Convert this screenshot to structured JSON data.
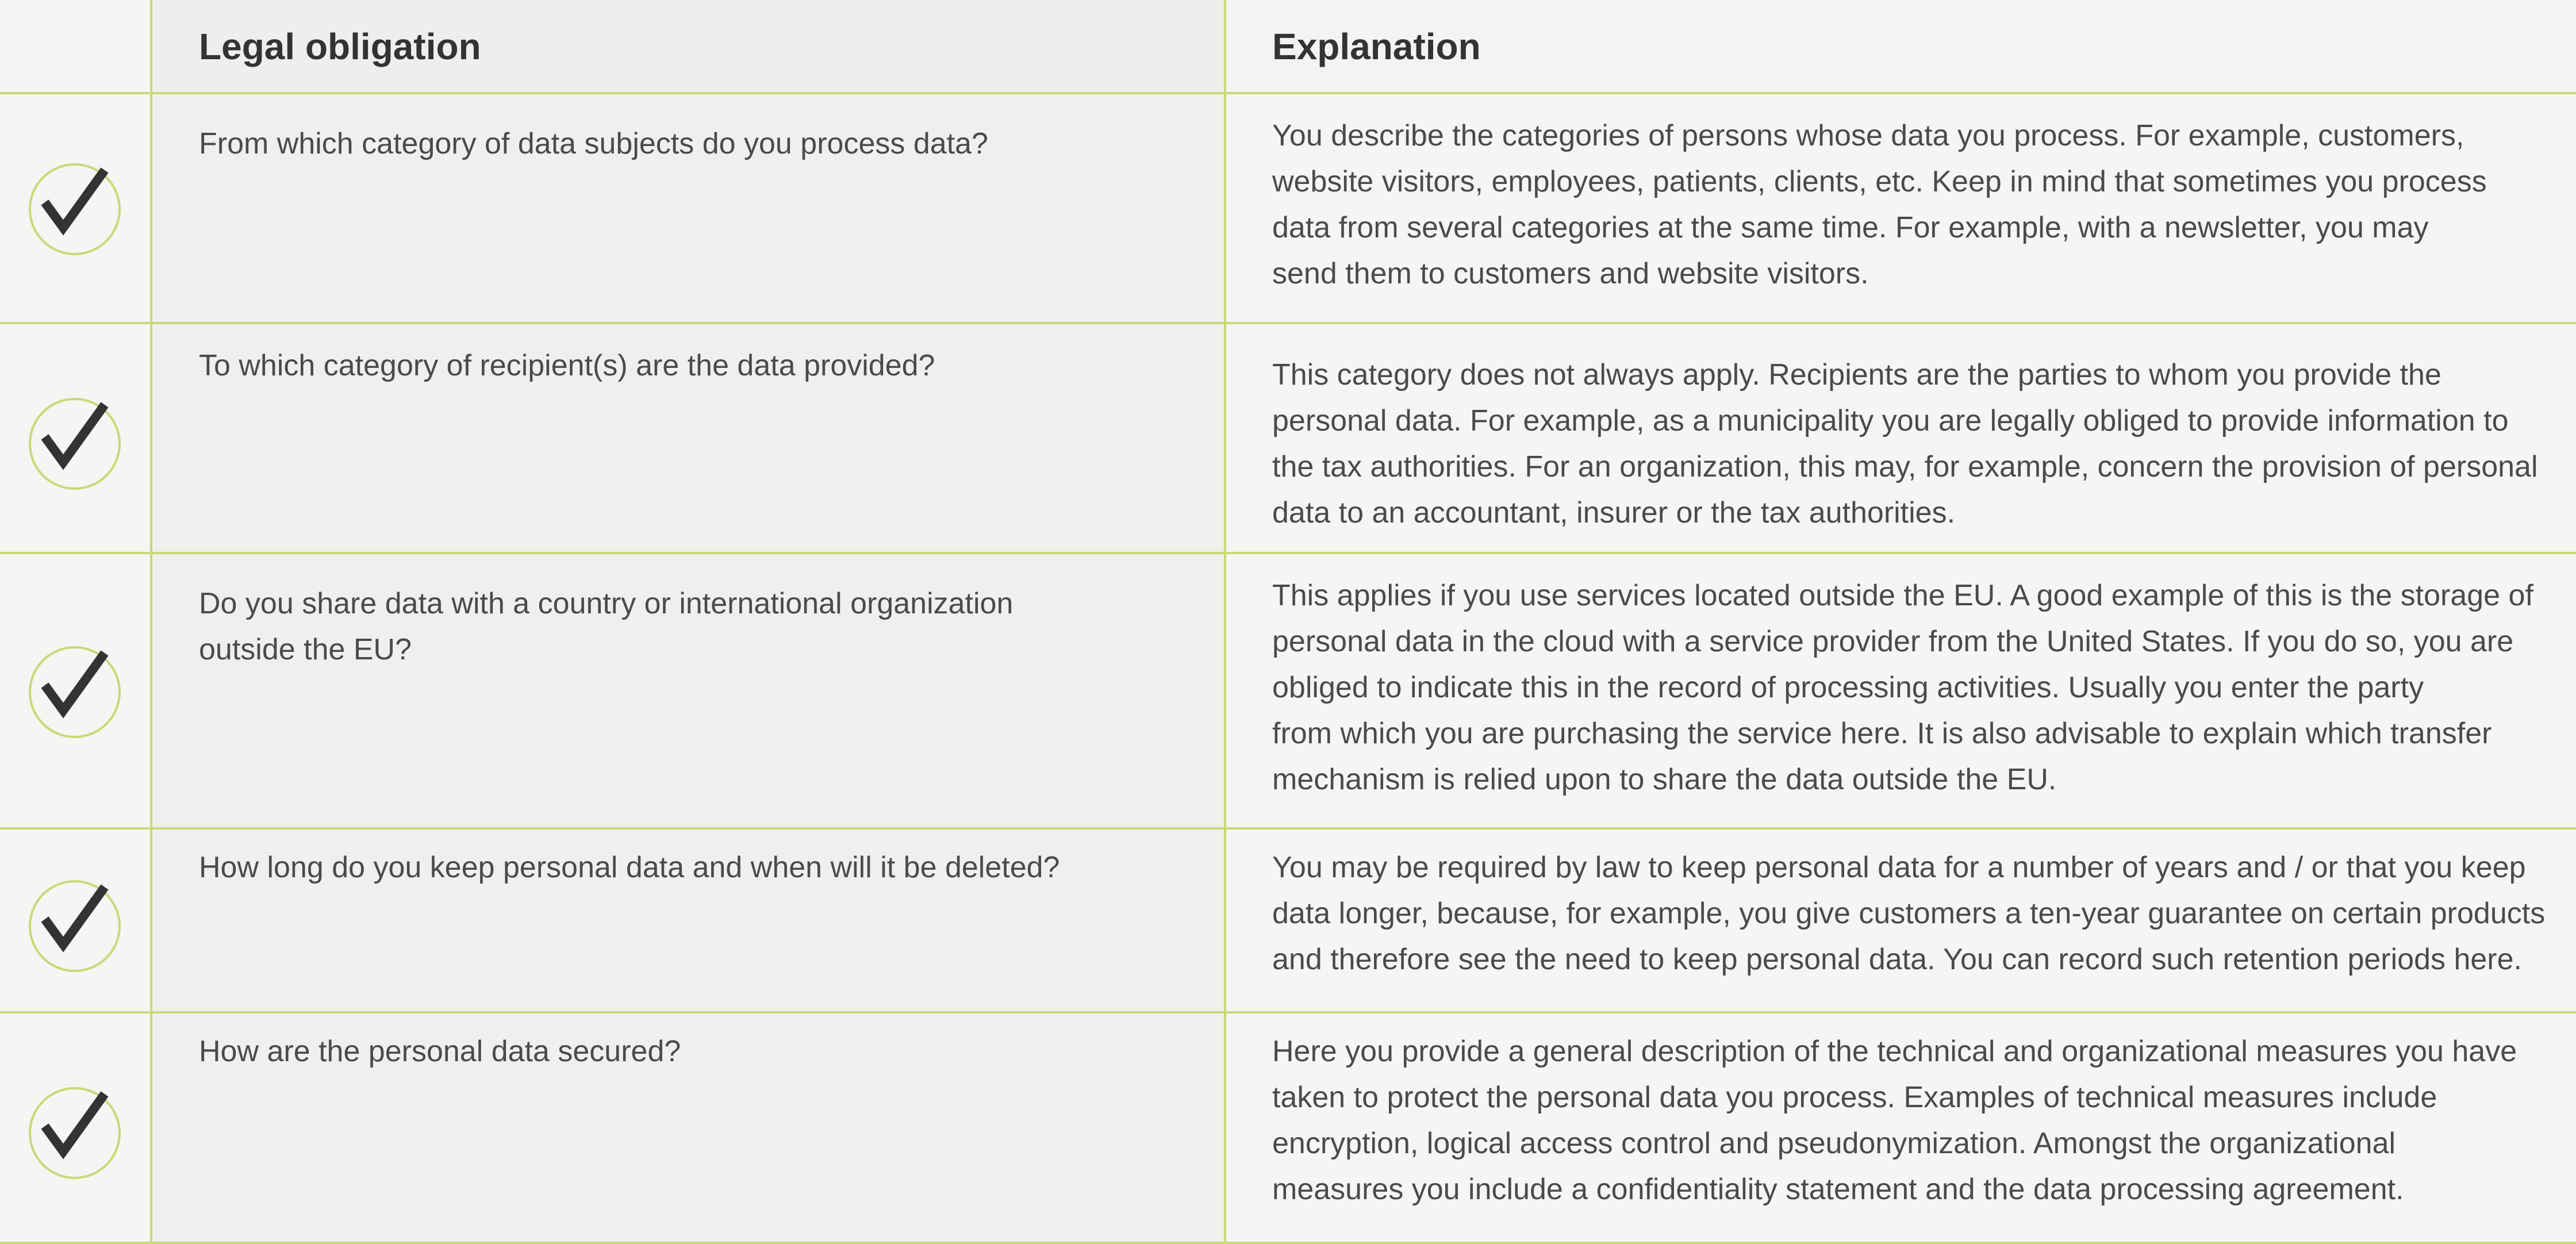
{
  "header": {
    "obligation_label": "Legal obligation",
    "explanation_label": "Explanation"
  },
  "colors": {
    "accent": "#c8d977",
    "check": "#333333",
    "text": "#4a4a4a"
  },
  "rows": [
    {
      "icon": "check-icon",
      "obligation": "From which category of data subjects do you process data?",
      "explanation": "You describe the categories of persons whose data you process. For example, customers,\nwebsite visitors, employees, patients, clients, etc. Keep in mind that sometimes you process\ndata from several categories at the same time. For example, with a newsletter, you may\nsend them to customers and website visitors."
    },
    {
      "icon": "check-icon",
      "obligation": "To which category of recipient(s) are the data provided?",
      "explanation": "This category does not always apply. Recipients are the parties to whom you provide the\npersonal data. For example, as a municipality you are legally obliged to provide information to\nthe tax authorities. For an organization, this may, for example, concern the provision of personal\ndata to an accountant, insurer or the tax authorities."
    },
    {
      "icon": "check-icon",
      "obligation": "Do you share data with a country or international organization\noutside the EU?",
      "explanation": "This applies if you use services located outside the EU. A good example of this is the storage of\npersonal data in the cloud with a service provider from the United States. If you do so, you are\nobliged to indicate this in the record of processing activities. Usually you enter the party\nfrom which you are purchasing the service here. It is also advisable to explain which transfer\nmechanism is relied upon to share the data outside the EU."
    },
    {
      "icon": "check-icon",
      "obligation": "How long do you keep personal data and when will it be deleted?",
      "explanation": "You may be required by law to keep personal data for a number of years and / or that you keep\ndata longer, because, for example, you give customers a ten-year guarantee on certain products\n and therefore see the need to keep personal data. You can record such retention periods here."
    },
    {
      "icon": "check-icon",
      "obligation": "How are the personal data secured?",
      "explanation": "Here you provide a general description of the technical and organizational measures you have\ntaken to protect the personal data you process. Examples of technical measures include\nencryption, logical access control and pseudonymization. Amongst the organizational\nmeasures you include a confidentiality statement and the data processing agreement."
    }
  ]
}
